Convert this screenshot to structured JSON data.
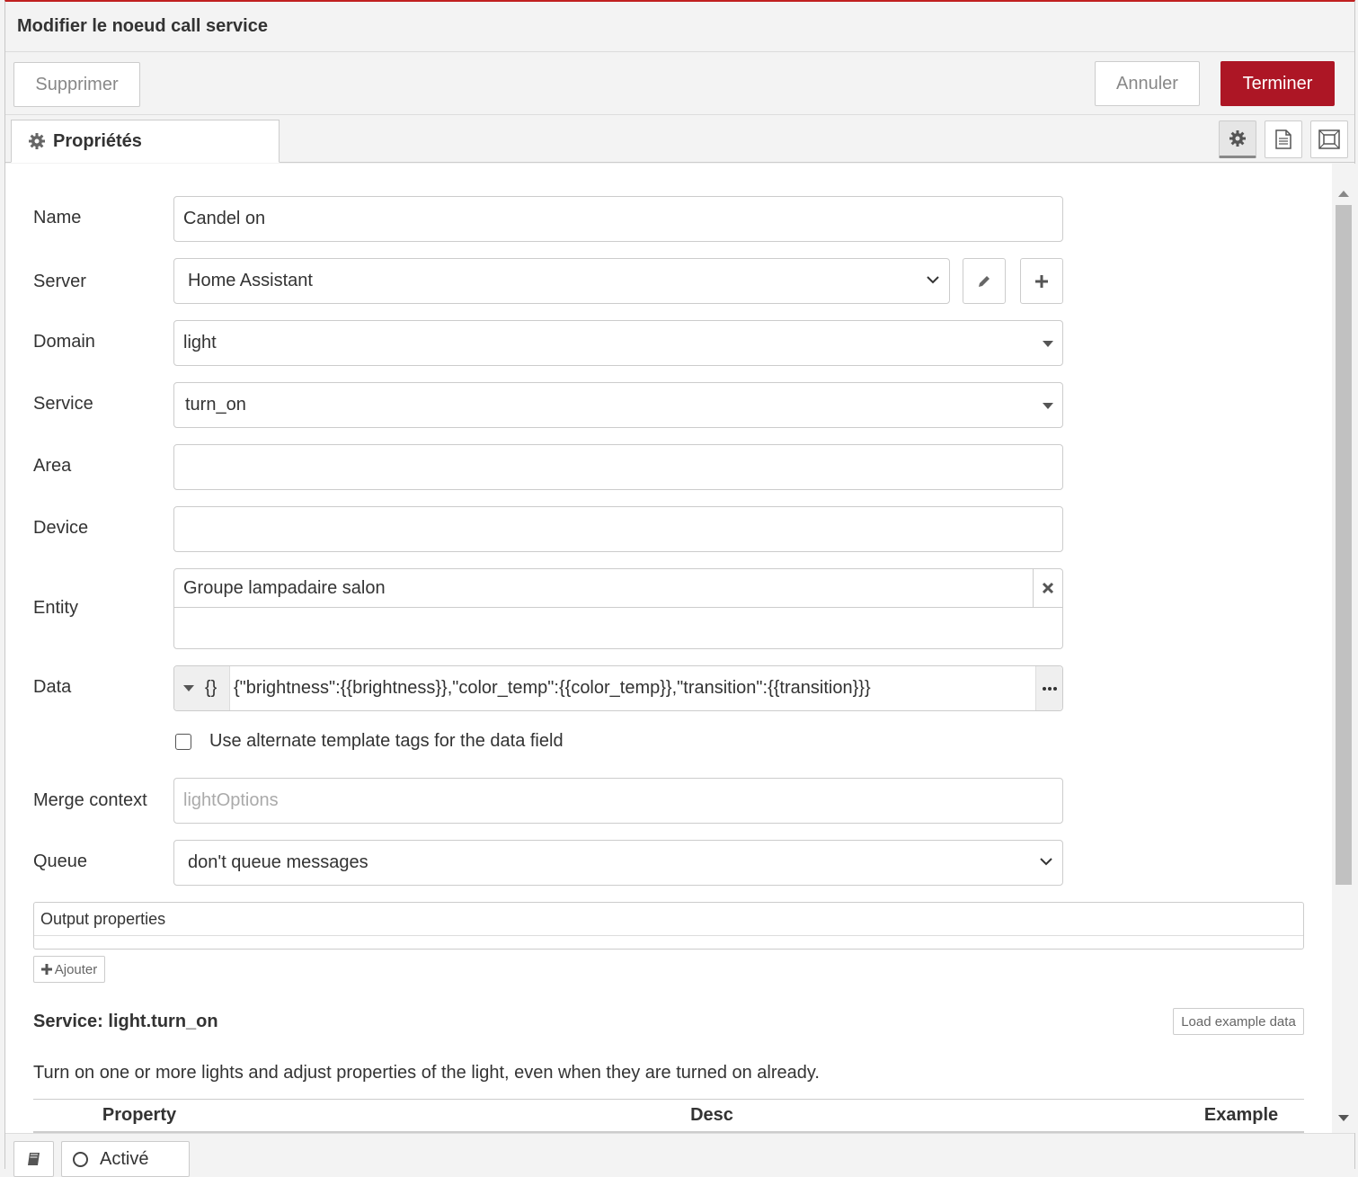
{
  "header": {
    "title": "Modifier le noeud call service"
  },
  "toolbar": {
    "delete_label": "Supprimer",
    "cancel_label": "Annuler",
    "done_label": "Terminer"
  },
  "tabs": {
    "properties_label": "Propriétés"
  },
  "form": {
    "name": {
      "label": "Name",
      "value": "Candel on"
    },
    "server": {
      "label": "Server",
      "value": "Home Assistant"
    },
    "domain": {
      "label": "Domain",
      "value": "light"
    },
    "service": {
      "label": "Service",
      "value": "turn_on"
    },
    "area": {
      "label": "Area",
      "value": ""
    },
    "device": {
      "label": "Device",
      "value": ""
    },
    "entity": {
      "label": "Entity",
      "value": "Groupe lampadaire salon"
    },
    "data": {
      "label": "Data",
      "type_symbol": "{}",
      "value": "{\"brightness\":{{brightness}},\"color_temp\":{{color_temp}},\"transition\":{{transition}}}"
    },
    "alt_tags": {
      "label": "Use alternate template tags for the data field",
      "checked": false
    },
    "merge_context": {
      "label": "Merge context",
      "placeholder": "lightOptions"
    },
    "queue": {
      "label": "Queue",
      "value": "don't queue messages"
    }
  },
  "output": {
    "legend": "Output properties",
    "add_label": "Ajouter"
  },
  "service_info": {
    "title": "Service: light.turn_on",
    "load_example_label": "Load example data",
    "description": "Turn on one or more lights and adjust properties of the light, even when they are turned on already.",
    "columns": [
      "Property",
      "Desc",
      "Example"
    ]
  },
  "footer": {
    "status_label": "Activé"
  },
  "colors": {
    "accent": "#ad1625",
    "top_border": "#c02020"
  }
}
